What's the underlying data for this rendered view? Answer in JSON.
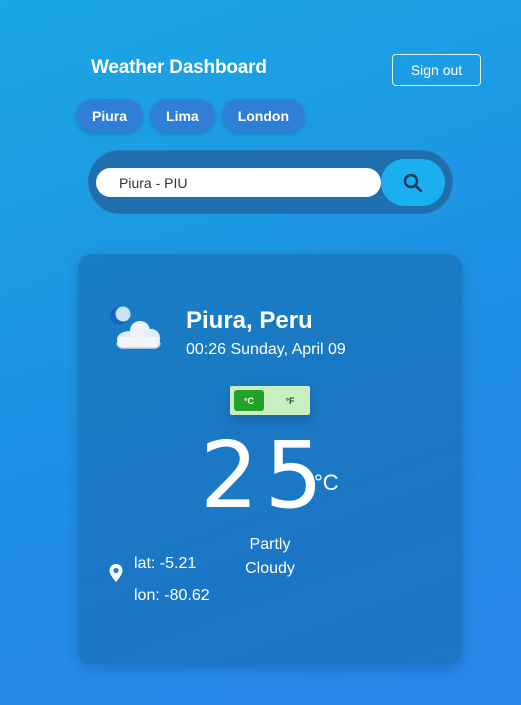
{
  "header": {
    "title": "Weather Dashboard",
    "sign_out_label": "Sign out"
  },
  "quick_cities": [
    {
      "label": "Piura"
    },
    {
      "label": "Lima"
    },
    {
      "label": "London"
    }
  ],
  "search": {
    "value": "Piura - PIU",
    "icon": "search-icon"
  },
  "weather": {
    "icon": "partly-cloudy-night-icon",
    "city": "Piura, Peru",
    "datetime": "00:26 Sunday, April 09",
    "unit_celsius": "°C",
    "unit_fahrenheit": "°F",
    "selected_unit": "°C",
    "temperature": "25",
    "temperature_unit": "°C",
    "condition_line1": "Partly",
    "condition_line2": "Cloudy",
    "lat": "lat: -5.21",
    "lon": "lon: -80.62",
    "location_icon": "map-pin-icon"
  },
  "colors": {
    "background_start": "#1aa7e3",
    "background_end": "#2a86ea",
    "unit_active": "#21a32a",
    "unit_toggle_bg": "#c8eec2",
    "search_button": "#1ab0ef"
  }
}
